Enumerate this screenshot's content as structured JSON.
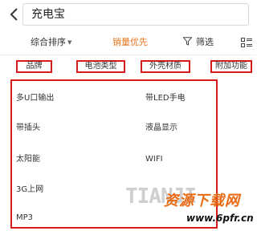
{
  "header": {
    "back_icon": "back-chevron-icon",
    "search_text": "充电宝"
  },
  "sort_bar": {
    "comprehensive": "综合排序",
    "sales": "销量优先",
    "filter": "筛选",
    "active_color": "#e8731b"
  },
  "filter_chips": [
    "品牌",
    "电池类型",
    "外壳材质",
    "附加功能"
  ],
  "function_options": {
    "left": [
      "多U口输出",
      "带插头",
      "太阳能",
      "3G上网",
      "MP3"
    ],
    "right": [
      "带LED手电",
      "液晶显示",
      "WIFI"
    ]
  },
  "watermark": {
    "en": "TIANJI",
    "cn": "资源下载网",
    "url": "www.6pfr.cn"
  },
  "colors": {
    "highlight_border": "#d51a1a",
    "accent": "#e8731b"
  }
}
